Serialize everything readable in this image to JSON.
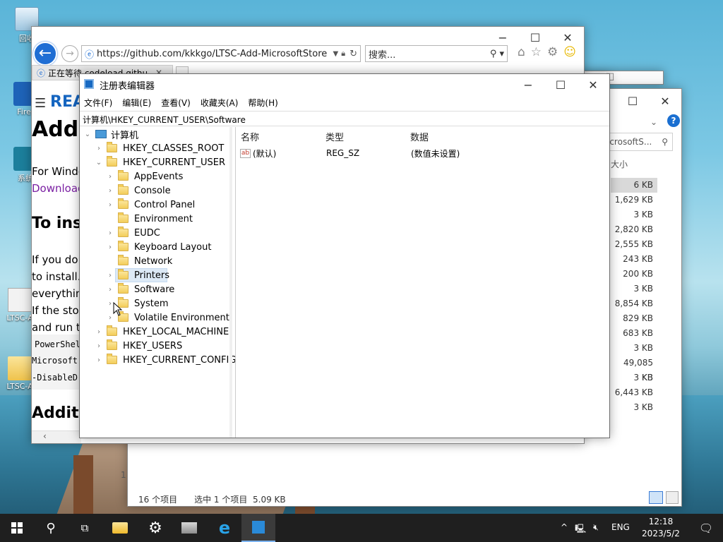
{
  "desktop": {
    "icons": [
      {
        "label": "回收",
        "icon": "recycle-bin-icon"
      },
      {
        "label": "Firef",
        "icon": "firefox-icon"
      },
      {
        "label": "系统",
        "icon": "system-icon"
      },
      {
        "label": "LTSC-A",
        "icon": "file-icon"
      },
      {
        "label": "LTSC-A",
        "icon": "folder-icon"
      }
    ]
  },
  "browser": {
    "url": "https://github.com/kkkgo/LTSC-Add-MicrosoftStore",
    "search_placeholder": "搜索...",
    "tab_label": "正在等待 codeload.githu...",
    "content": {
      "readme": "REA",
      "h1": "Add",
      "p1": "For Windo",
      "link": "Download",
      "h2": "To ins",
      "p2a": "If you do",
      "p2b": "to install.",
      "p2c": "everything",
      "p2d": "If the stor",
      "p2e": "and run th",
      "code1": "PowerShel",
      "code2": "Microsoft",
      "code3": "-DisableD",
      "h3": "Additi"
    }
  },
  "explorer": {
    "search_value": "icrosoftS...",
    "size_header": "大小",
    "sizes": [
      "6 KB",
      "1,629 KB",
      "3 KB",
      "2,820 KB",
      "2,555 KB",
      "243 KB",
      "200 KB",
      "3 KB",
      "8,854 KB",
      "829 KB",
      "683 KB",
      "3 KB",
      "49,085 KB",
      "3 KB",
      "6,443 KB",
      "3 KB"
    ],
    "status_count": "16 个项目",
    "status_selected": "选中 1 个项目",
    "status_size": "5.09 KB",
    "left_num": "1"
  },
  "regedit": {
    "title": "注册表编辑器",
    "menu": [
      "文件(F)",
      "编辑(E)",
      "查看(V)",
      "收藏夹(A)",
      "帮助(H)"
    ],
    "path": "计算机\\HKEY_CURRENT_USER\\Software",
    "tree": {
      "root": "计算机",
      "hkcr": "HKEY_CLASSES_ROOT",
      "hkcu": "HKEY_CURRENT_USER",
      "children": [
        "AppEvents",
        "Console",
        "Control Panel",
        "Environment",
        "EUDC",
        "Keyboard Layout",
        "Network",
        "Printers",
        "Software",
        "System",
        "Volatile Environment"
      ],
      "hklm": "HKEY_LOCAL_MACHINE",
      "hku": "HKEY_USERS",
      "hkcc": "HKEY_CURRENT_CONFIG"
    },
    "columns": {
      "name": "名称",
      "type": "类型",
      "data": "数据"
    },
    "values": [
      {
        "name": "(默认)",
        "type": "REG_SZ",
        "data": "(数值未设置)"
      }
    ]
  },
  "taskbar": {
    "lang": "ENG",
    "time": "12:18",
    "date": "2023/5/2"
  }
}
